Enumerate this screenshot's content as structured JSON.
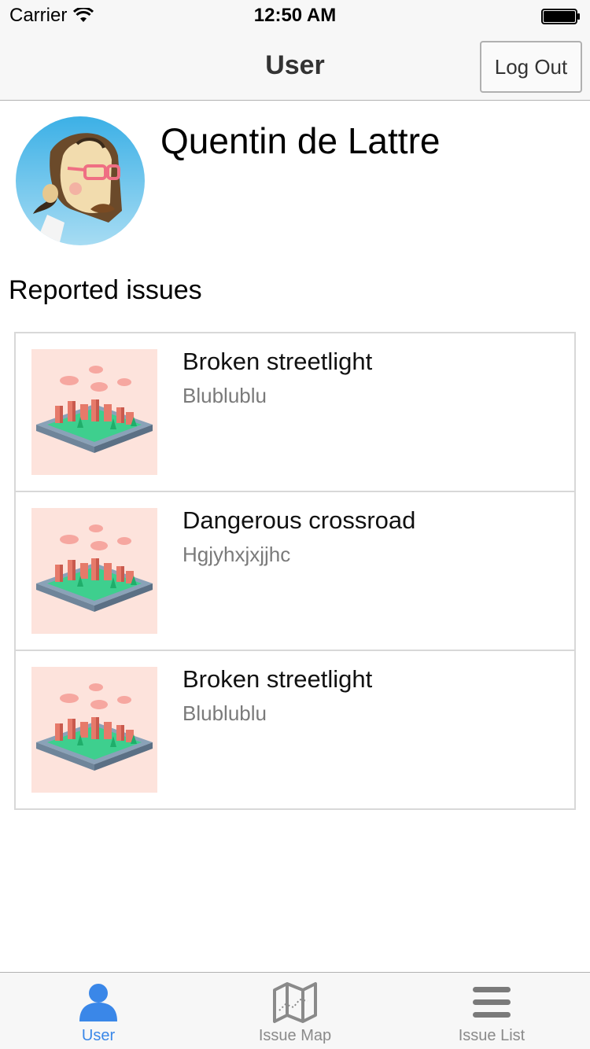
{
  "status_bar": {
    "carrier": "Carrier",
    "time": "12:50 AM"
  },
  "nav": {
    "title": "User",
    "logout_label": "Log Out"
  },
  "profile": {
    "name": "Quentin de Lattre"
  },
  "section_title": "Reported issues",
  "issues": [
    {
      "title": "Broken streetlight",
      "subtitle": "Blublublu"
    },
    {
      "title": "Dangerous crossroad",
      "subtitle": "Hgjyhxjxjjhc"
    },
    {
      "title": "Broken streetlight",
      "subtitle": "Blublublu"
    }
  ],
  "tabs": [
    {
      "label": "User",
      "icon": "user-icon",
      "active": true
    },
    {
      "label": "Issue Map",
      "icon": "map-icon",
      "active": false
    },
    {
      "label": "Issue List",
      "icon": "list-icon",
      "active": false
    }
  ],
  "colors": {
    "accent": "#3a87e8",
    "thumb_bg": "#fde3dc",
    "bar_bg": "#f7f7f7"
  }
}
